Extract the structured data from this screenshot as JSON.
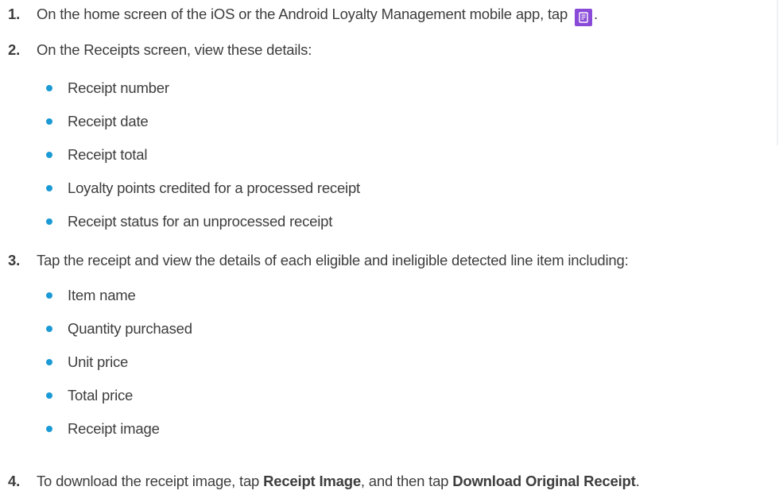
{
  "steps": [
    {
      "number": "1.",
      "text_before": "On the home screen of the iOS or the Android Loyalty Management mobile app, tap",
      "icon": "receipts-icon",
      "text_after": "."
    },
    {
      "number": "2.",
      "text": "On the Receipts screen, view these details:",
      "bullets": [
        "Receipt number",
        "Receipt date",
        "Receipt total",
        "Loyalty points credited for a processed receipt",
        "Receipt status for an unprocessed receipt"
      ]
    },
    {
      "number": "3.",
      "text": "Tap the receipt and view the details of each eligible and ineligible detected line item including:",
      "bullets": [
        "Item name",
        "Quantity purchased",
        "Unit price",
        "Total price",
        "Receipt image"
      ]
    },
    {
      "number": "4.",
      "part1": "To download the receipt image, tap ",
      "bold1": "Receipt Image",
      "part2": ", and then tap ",
      "bold2": "Download Original Receipt",
      "part3": "."
    }
  ],
  "colors": {
    "bullet": "#1b9ad6",
    "icon_bg": "#8a4ad8"
  }
}
